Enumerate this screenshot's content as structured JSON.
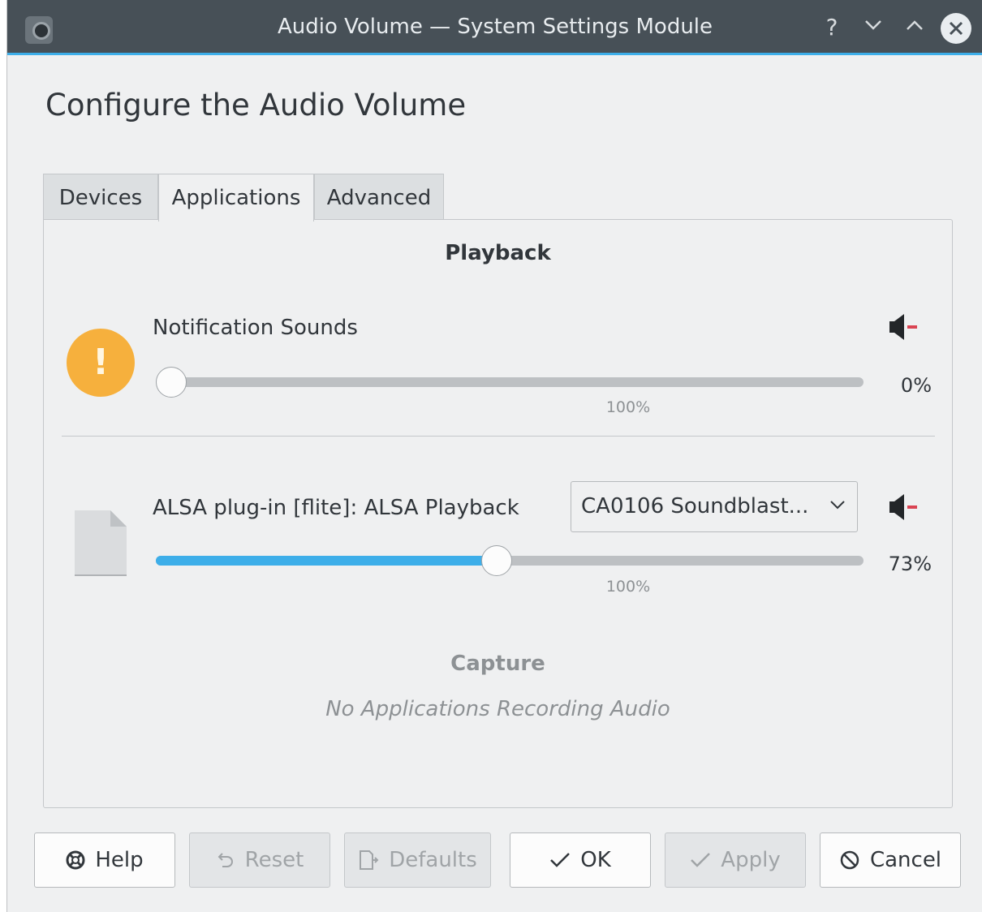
{
  "window": {
    "title": "Audio Volume — System Settings Module",
    "titlebar_buttons": {
      "help": "?",
      "minimize": "chevron-down-icon",
      "maximize": "chevron-up-icon",
      "close": "close-icon"
    }
  },
  "heading": "Configure the Audio Volume",
  "tabs": [
    {
      "label": "Devices",
      "active": false
    },
    {
      "label": "Applications",
      "active": true
    },
    {
      "label": "Advanced",
      "active": false
    }
  ],
  "playback": {
    "title": "Playback",
    "streams": [
      {
        "name": "Notification Sounds",
        "icon": "warning-icon",
        "icon_glyph": "!",
        "volume": 0,
        "volume_text": "0%",
        "mark_label": "100%",
        "muted_icon": "speaker-muted-icon"
      },
      {
        "name": "ALSA plug-in [flite]: ALSA Playback",
        "icon": "file-icon",
        "device": "CA0106 Soundblast...",
        "volume": 0.73,
        "volume_text": "73%",
        "mark_label": "100%",
        "muted_icon": "speaker-muted-icon"
      }
    ]
  },
  "capture": {
    "title": "Capture",
    "empty_text": "No Applications Recording Audio"
  },
  "buttons": {
    "help": "Help",
    "reset": "Reset",
    "defaults": "Defaults",
    "ok": "OK",
    "apply": "Apply",
    "cancel": "Cancel"
  },
  "colors": {
    "accent": "#3daee9",
    "titlebar": "#475057",
    "warning": "#f6b03d",
    "mute_red": "#da4453"
  }
}
